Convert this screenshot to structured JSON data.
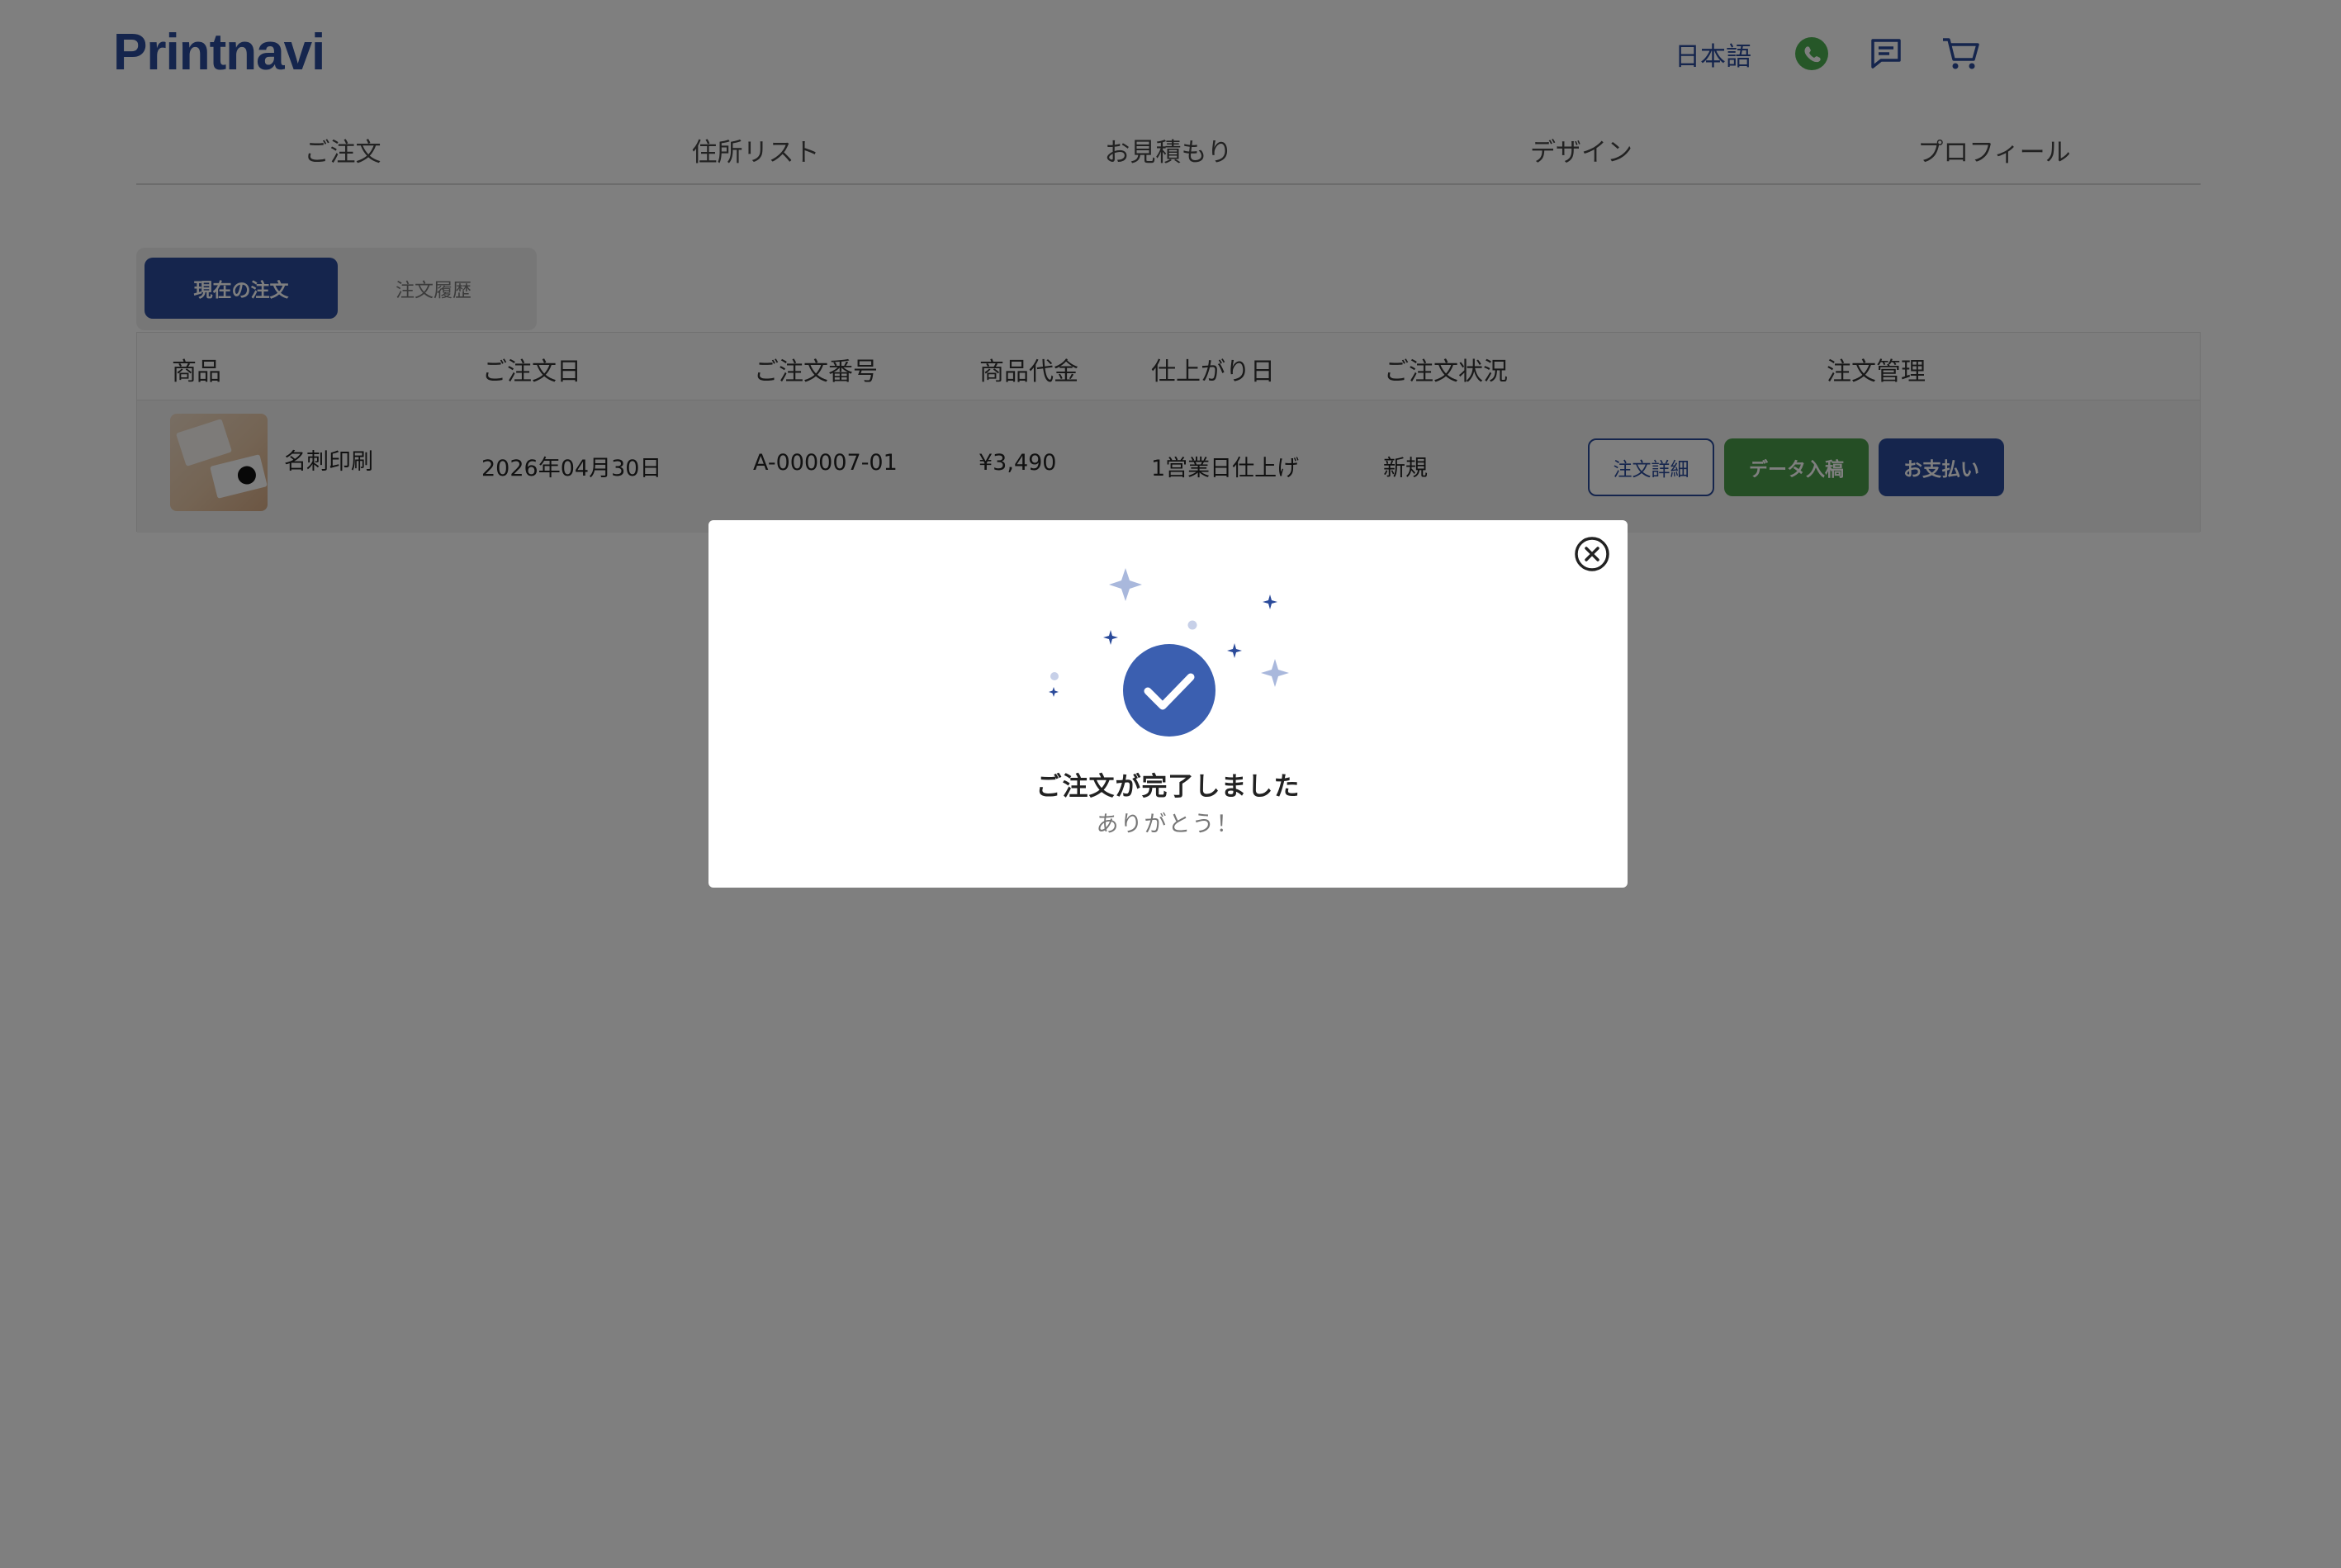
{
  "header": {
    "logo": "Printnavi",
    "language": "日本語",
    "icons": [
      "whatsapp-icon",
      "chat-icon",
      "cart-icon"
    ]
  },
  "nav": {
    "items": [
      {
        "label": "ご注文"
      },
      {
        "label": "住所リスト"
      },
      {
        "label": "お見積もり"
      },
      {
        "label": "デザイン"
      },
      {
        "label": "プロフィール"
      }
    ]
  },
  "tabs": {
    "current": "現在の注文",
    "history": "注文履歴"
  },
  "table": {
    "headers": {
      "product": "商品",
      "order_date": "ご注文日",
      "order_number": "ご注文番号",
      "price": "商品代金",
      "finish_date": "仕上がり日",
      "status": "ご注文状況",
      "manage": "注文管理"
    },
    "rows": [
      {
        "product": "名刺印刷",
        "order_date": "2026年04月30日",
        "order_number": "A-000007-01",
        "price": "¥3,490",
        "finish_date": "1営業日仕上げ",
        "status": "新規",
        "actions": {
          "detail": "注文詳細",
          "data": "データ入稿",
          "pay": "お支払い"
        }
      }
    ]
  },
  "modal": {
    "title": "ご注文が完了しました",
    "subtitle": "ありがとう！"
  },
  "colors": {
    "brand": "#2a4a9a",
    "accent_green": "#4b9c4a",
    "check_circle": "#3b5fb0",
    "sparkle_light": "#a9b8dc",
    "whatsapp": "#4caf50"
  }
}
